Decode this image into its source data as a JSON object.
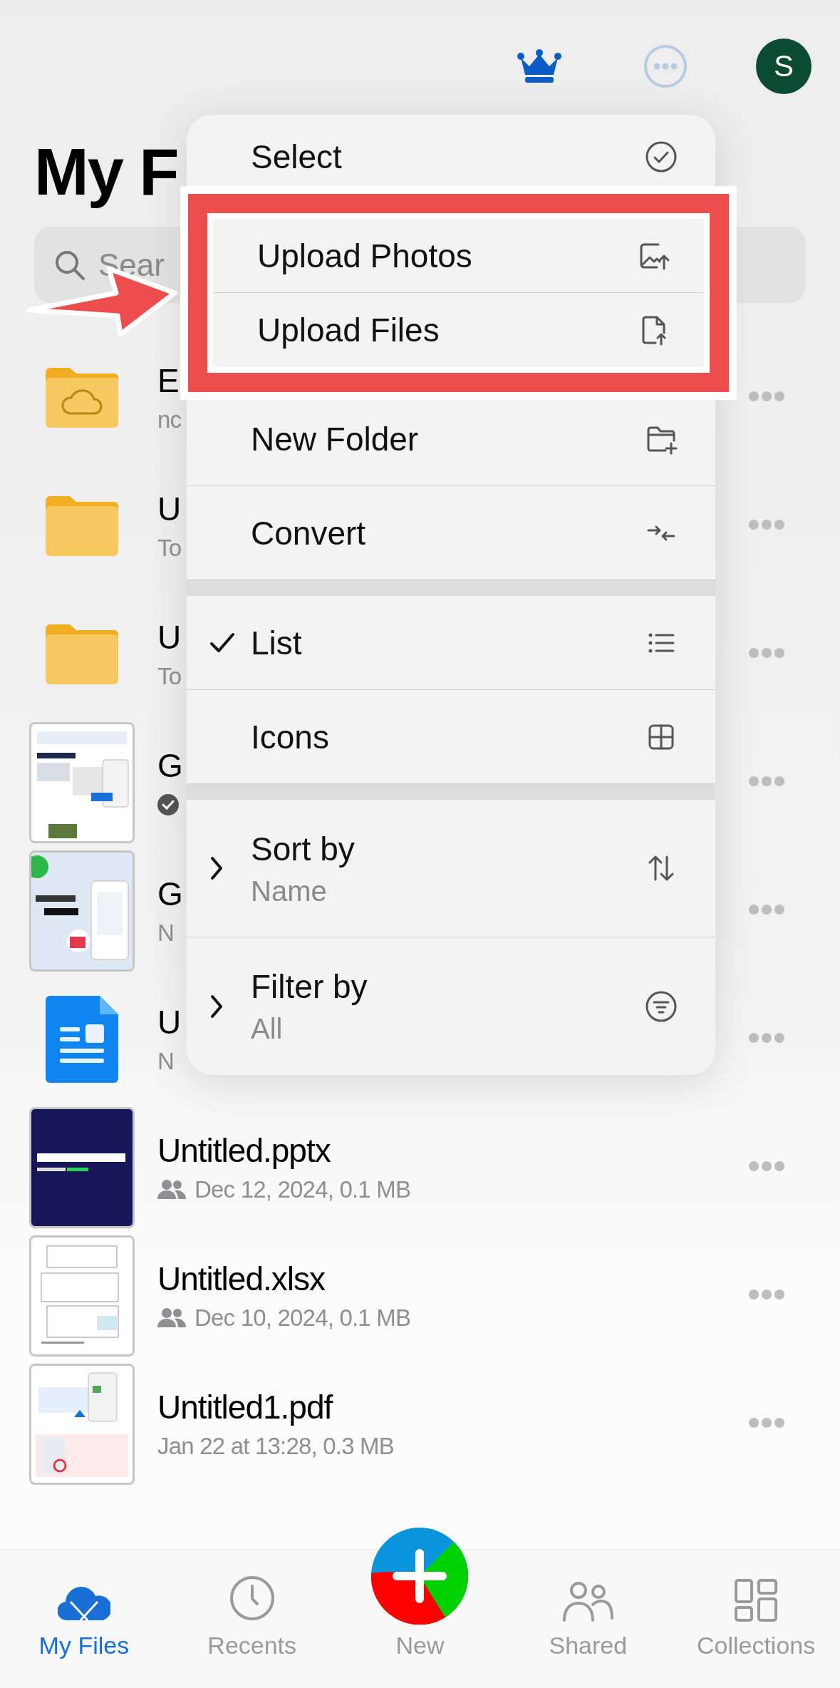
{
  "header": {
    "avatar": "S"
  },
  "title": "My F",
  "search": {
    "placeholder": "Sear"
  },
  "files": [
    {
      "kind": "cloud-folder",
      "name": "E",
      "meta": "nc",
      "shared": false,
      "synced": false
    },
    {
      "kind": "folder",
      "name": "U",
      "meta": "To",
      "shared": false,
      "synced": false
    },
    {
      "kind": "folder",
      "name": "U",
      "meta": "To",
      "shared": false,
      "synced": false
    },
    {
      "kind": "picture",
      "name": "G",
      "shared": false,
      "synced": true
    },
    {
      "kind": "picture",
      "name": "G",
      "meta": "N",
      "shared": false,
      "synced": false
    },
    {
      "kind": "document",
      "name": "U",
      "meta": "N",
      "shared": false,
      "synced": false
    },
    {
      "kind": "picture",
      "name": "Untitled.pptx",
      "meta": "Dec 12, 2024, 0.1 MB",
      "shared": true,
      "synced": false
    },
    {
      "kind": "picture",
      "name": "Untitled.xlsx",
      "meta": "Dec 10, 2024, 0.1 MB",
      "shared": true,
      "synced": false
    },
    {
      "kind": "picture",
      "name": "Untitled1.pdf",
      "meta": "Jan 22 at 13:28, 0.3 MB",
      "shared": false,
      "synced": false
    }
  ],
  "menu": {
    "sections": [
      [
        {
          "kind": "action",
          "label": "Select",
          "highlighted": false
        },
        {
          "kind": "action",
          "label": "Upload Photos",
          "highlighted": true
        },
        {
          "kind": "action",
          "label": "Upload Files",
          "highlighted": true
        },
        {
          "kind": "action",
          "label": "New Folder",
          "highlighted": false
        },
        {
          "kind": "action",
          "label": "Convert",
          "highlighted": false
        }
      ],
      [
        {
          "kind": "option",
          "label": "List",
          "checked": true
        },
        {
          "kind": "option",
          "label": "Icons",
          "checked": false
        }
      ],
      [
        {
          "kind": "submenu",
          "label": "Sort by",
          "value": "Name"
        },
        {
          "kind": "submenu",
          "label": "Filter by",
          "value": "All"
        }
      ]
    ]
  },
  "tabs": [
    {
      "label": "My Files",
      "selected": true
    },
    {
      "label": "Recents",
      "selected": false
    },
    {
      "label": "New",
      "selected": false
    },
    {
      "label": "Shared",
      "selected": false
    },
    {
      "label": "Collections",
      "selected": false
    }
  ]
}
